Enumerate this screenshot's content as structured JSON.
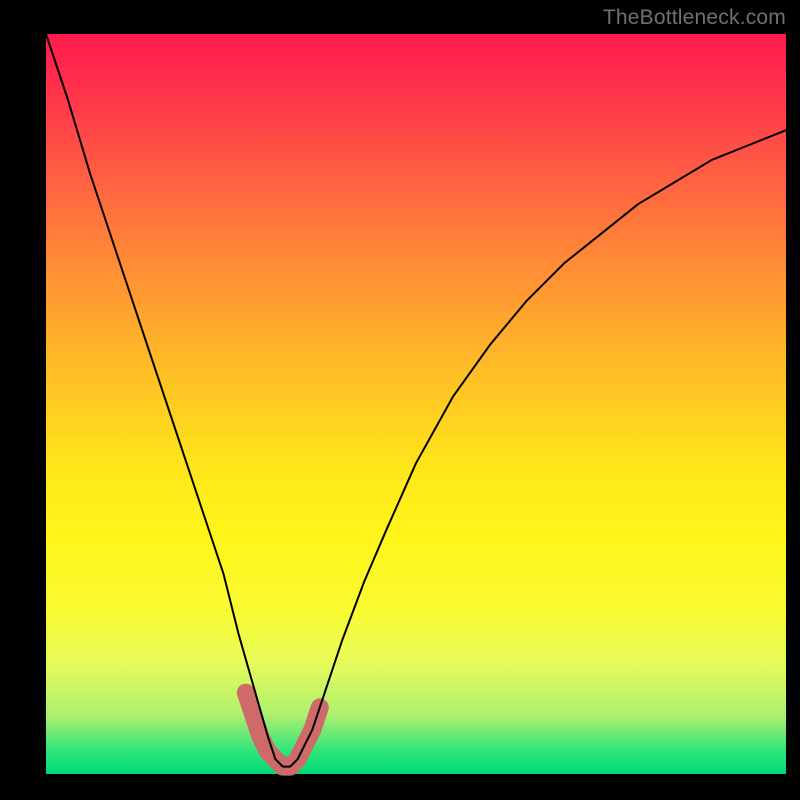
{
  "watermark": {
    "text": "TheBottleneck.com"
  },
  "chart_data": {
    "type": "line",
    "title": "",
    "xlabel": "",
    "ylabel": "",
    "xlim": [
      0,
      100
    ],
    "ylim": [
      0,
      100
    ],
    "grid": false,
    "legend": false,
    "background_gradient": {
      "stops": [
        {
          "pos": 0.0,
          "color": "#ff1a4d"
        },
        {
          "pos": 0.5,
          "color": "#ffd21f"
        },
        {
          "pos": 0.78,
          "color": "#f9fb33"
        },
        {
          "pos": 0.97,
          "color": "#2de47a"
        },
        {
          "pos": 1.0,
          "color": "#00d977"
        }
      ]
    },
    "series": [
      {
        "name": "bottleneck-curve",
        "color": "#000000",
        "stroke_width": 2,
        "x": [
          0,
          3,
          6,
          9,
          12,
          15,
          18,
          21,
          24,
          26,
          28,
          30,
          31,
          32,
          33,
          34,
          36,
          38,
          40,
          43,
          46,
          50,
          55,
          60,
          65,
          70,
          75,
          80,
          85,
          90,
          95,
          100
        ],
        "y": [
          100,
          91,
          81,
          72,
          63,
          54,
          45,
          36,
          27,
          19,
          12,
          5,
          2,
          1,
          1,
          2,
          6,
          12,
          18,
          26,
          33,
          42,
          51,
          58,
          64,
          69,
          73,
          77,
          80,
          83,
          85,
          87
        ]
      },
      {
        "name": "highlight-near-minimum",
        "color": "#cf6a6a",
        "stroke_width": 18,
        "linecap": "round",
        "x": [
          27,
          28,
          29,
          30,
          31,
          32,
          33,
          34,
          35,
          36,
          37
        ],
        "y": [
          11,
          8,
          5,
          3,
          2,
          1,
          1,
          2,
          4,
          6,
          9
        ]
      }
    ],
    "minimum": {
      "x": 32.5,
      "y": 1
    }
  }
}
